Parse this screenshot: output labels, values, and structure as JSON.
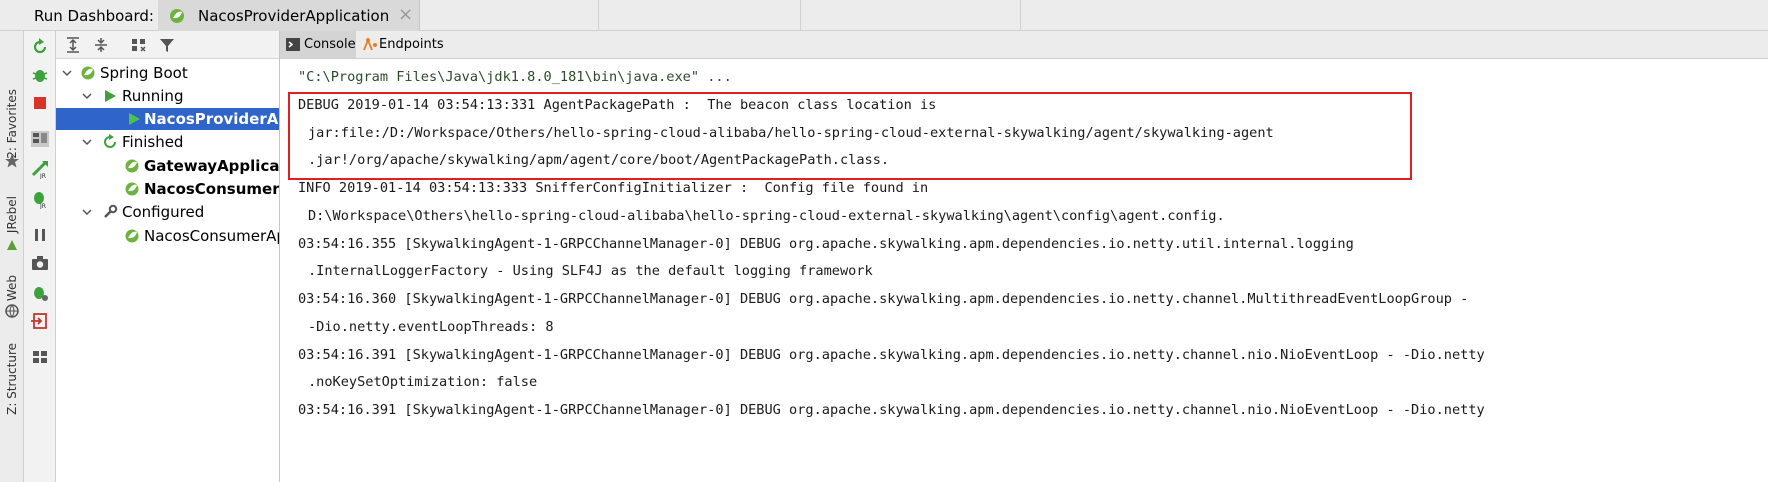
{
  "header": {
    "title": "Run Dashboard:",
    "tab_label": "NacosProviderApplication"
  },
  "side_strip": {
    "labels": [
      "2: Favorites",
      "JRebel",
      "Web",
      "Z: Structure"
    ]
  },
  "console_tabs": [
    {
      "label": "Console",
      "active": true
    },
    {
      "label": "Endpoints",
      "active": false
    }
  ],
  "tree": {
    "spring_boot": "Spring Boot",
    "running": "Running",
    "running_apps": [
      "NacosProviderApplication"
    ],
    "finished": "Finished",
    "finished_apps": [
      "GatewayApplication",
      "NacosConsumerFeignApplication"
    ],
    "configured": "Configured",
    "configured_apps": [
      "NacosConsumerApplication"
    ]
  },
  "log": {
    "cmd": "\"C:\\Program Files\\Java\\jdk1.8.0_181\\bin\\java.exe\" ...",
    "lines": [
      "DEBUG 2019-01-14 03:54:13:331 AgentPackagePath :  The beacon class location is",
      "jar:file:/D:/Workspace/Others/hello-spring-cloud-alibaba/hello-spring-cloud-external-skywalking/agent/skywalking-agent",
      ".jar!/org/apache/skywalking/apm/agent/core/boot/AgentPackagePath.class.",
      "INFO 2019-01-14 03:54:13:333 SnifferConfigInitializer :  Config file found in",
      "D:\\Workspace\\Others\\hello-spring-cloud-alibaba\\hello-spring-cloud-external-skywalking\\agent\\config\\agent.config.",
      "03:54:16.355 [SkywalkingAgent-1-GRPCChannelManager-0] DEBUG org.apache.skywalking.apm.dependencies.io.netty.util.internal.logging",
      ".InternalLoggerFactory - Using SLF4J as the default logging framework",
      "03:54:16.360 [SkywalkingAgent-1-GRPCChannelManager-0] DEBUG org.apache.skywalking.apm.dependencies.io.netty.channel.MultithreadEventLoopGroup -",
      "-Dio.netty.eventLoopThreads: 8",
      "03:54:16.391 [SkywalkingAgent-1-GRPCChannelManager-0] DEBUG org.apache.skywalking.apm.dependencies.io.netty.channel.nio.NioEventLoop - -Dio.netty",
      ".noKeySetOptimization: false",
      "03:54:16.391 [SkywalkingAgent-1-GRPCChannelManager-0] DEBUG org.apache.skywalking.apm.dependencies.io.netty.channel.nio.NioEventLoop - -Dio.netty"
    ]
  },
  "colors": {
    "selection": "#2f65ca",
    "highlight_border": "#e02020",
    "run_green": "#3da13d",
    "spring_green": "#6db33f"
  }
}
